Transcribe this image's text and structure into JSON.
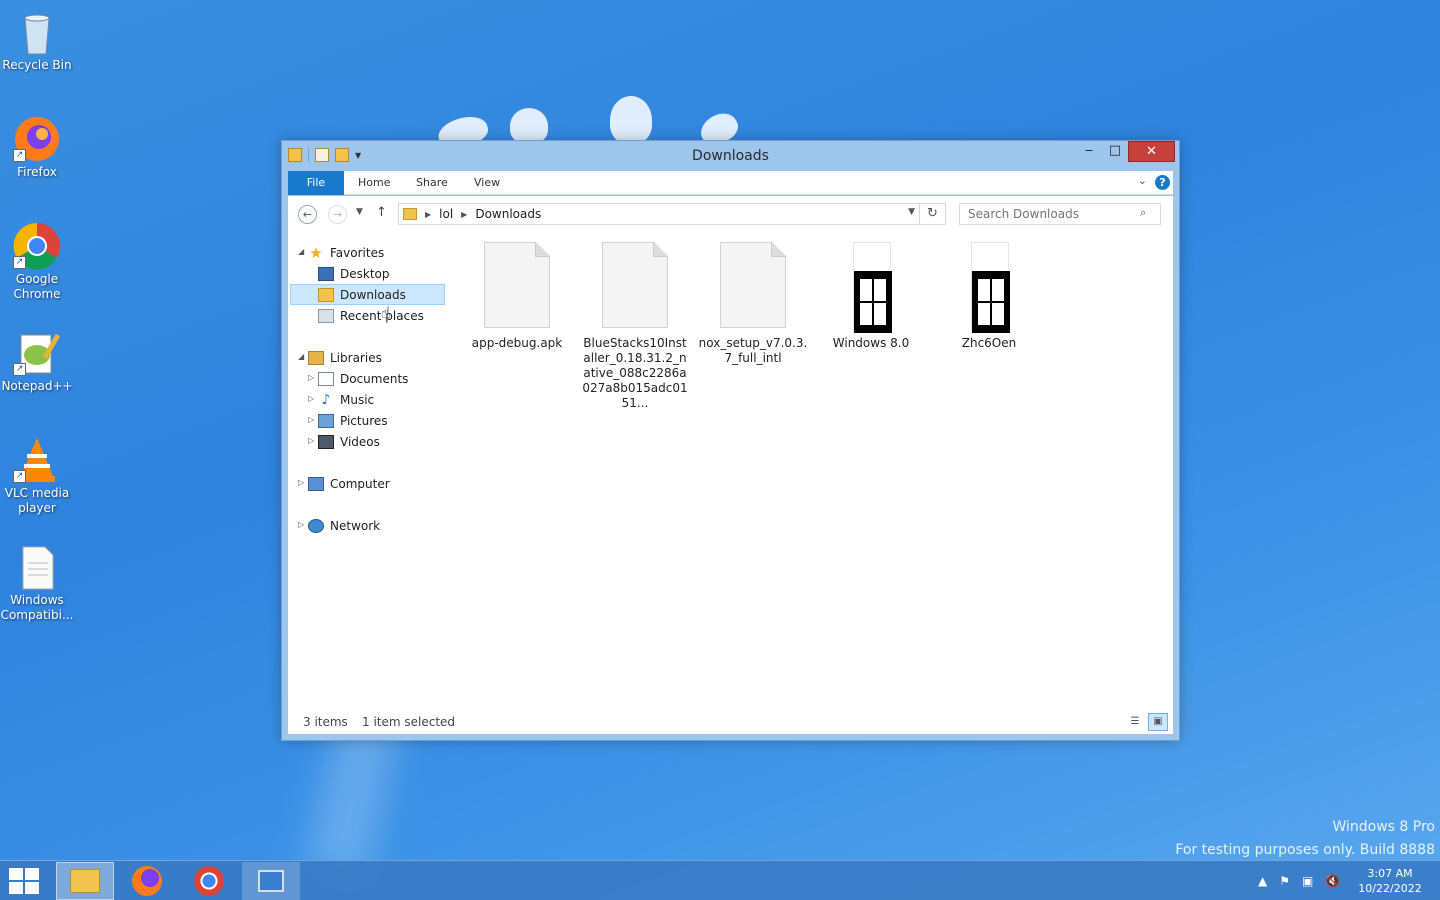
{
  "desktop": {
    "icons": [
      {
        "label": "Recycle Bin",
        "icon": "recycle-bin-icon"
      },
      {
        "label": "Firefox",
        "icon": "firefox-icon"
      },
      {
        "label": "Google Chrome",
        "icon": "chrome-icon"
      },
      {
        "label": "Notepad++",
        "icon": "notepad-plus-plus-icon"
      },
      {
        "label": "VLC media player",
        "icon": "vlc-icon"
      },
      {
        "label": "Windows Compatibi...",
        "icon": "document-icon"
      }
    ],
    "watermark": {
      "line1": "Windows 8 Pro",
      "line2": "For testing purposes only. Build 8888"
    }
  },
  "window": {
    "title": "Downloads",
    "controls": {
      "minimize": "‒",
      "maximize": "□",
      "close": "✕"
    },
    "ribbon_tabs": [
      {
        "label": "File"
      },
      {
        "label": "Home"
      },
      {
        "label": "Share"
      },
      {
        "label": "View"
      }
    ],
    "help": "?",
    "address": {
      "segments": [
        "lol",
        "Downloads"
      ]
    },
    "search": {
      "placeholder": "Search Downloads"
    },
    "nav_pane": {
      "favorites": {
        "label": "Favorites",
        "items": [
          "Desktop",
          "Downloads",
          "Recent places"
        ]
      },
      "libraries": {
        "label": "Libraries",
        "items": [
          "Documents",
          "Music",
          "Pictures",
          "Videos"
        ]
      },
      "computer": "Computer",
      "network": "Network"
    },
    "files": [
      {
        "name": "app-debug.apk",
        "type": "document"
      },
      {
        "name": "BlueStacks10Installer_0.18.31.2_native_088c2286a027a8b015adc0151...",
        "type": "document"
      },
      {
        "name": "nox_setup_v7.0.3.7_full_intl",
        "type": "document"
      },
      {
        "name": "Windows 8.0",
        "type": "windows-image"
      },
      {
        "name": "Zhc6Oen",
        "type": "windows-image"
      }
    ],
    "status": {
      "count": "3 items",
      "selection": "1 item selected"
    }
  },
  "taskbar": {
    "apps": [
      "File Explorer",
      "Firefox",
      "Google Chrome",
      "Remote Desktop"
    ],
    "clock": {
      "time": "3:07 AM",
      "date": "10/22/2022"
    }
  },
  "colors": {
    "accent": "#1979ca",
    "close": "#c7403a",
    "selection": "#cce8ff"
  }
}
